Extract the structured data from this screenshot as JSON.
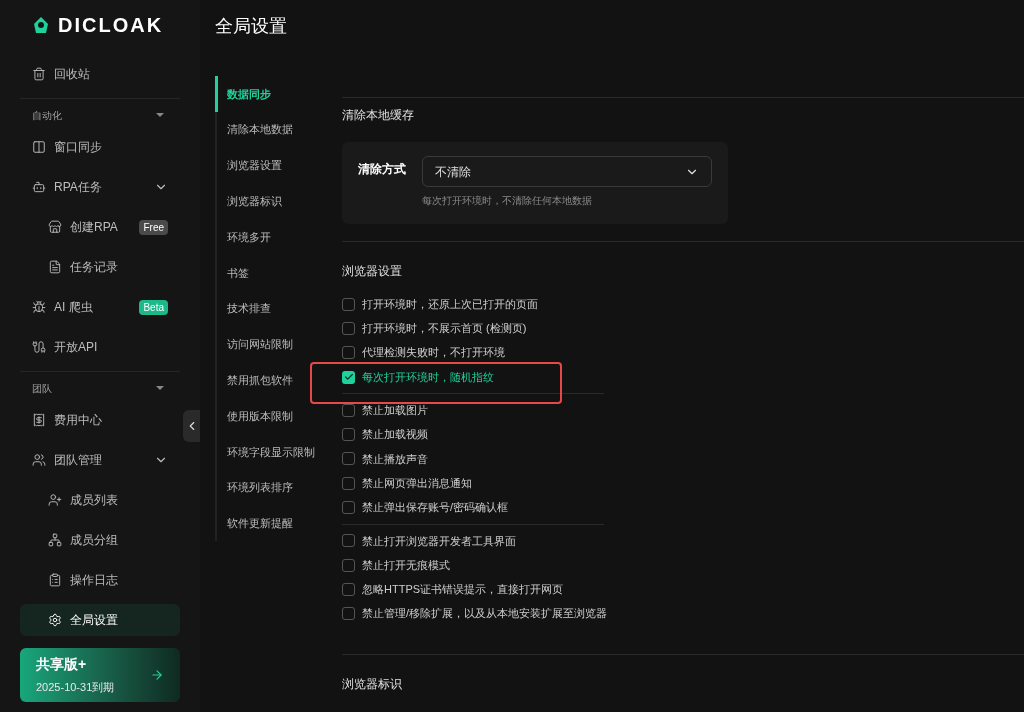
{
  "brand": {
    "name": "DICLOAK"
  },
  "sidebar": {
    "groups": [
      {
        "items": [
          {
            "label": "回收站",
            "selected": false
          }
        ]
      },
      {
        "header": "自动化",
        "items": [
          {
            "label": "窗口同步",
            "selected": false
          },
          {
            "label": "RPA任务",
            "selected": false,
            "expanded": true,
            "children": [
              {
                "label": "创建RPA",
                "selected": false,
                "badge": {
                  "text": "Free",
                  "color": "#4a4a4a"
                }
              },
              {
                "label": "任务记录",
                "selected": false
              }
            ]
          },
          {
            "label": "AI 爬虫",
            "selected": false,
            "badge": {
              "text": "Beta",
              "color": "#1db88a"
            }
          },
          {
            "label": "开放API",
            "selected": false
          }
        ]
      },
      {
        "header": "团队",
        "items": [
          {
            "label": "费用中心",
            "selected": false
          },
          {
            "label": "团队管理",
            "selected": false,
            "expanded": true,
            "children": [
              {
                "label": "成员列表",
                "selected": false
              },
              {
                "label": "成员分组",
                "selected": false
              },
              {
                "label": "操作日志",
                "selected": false
              },
              {
                "label": "全局设置",
                "selected": true
              }
            ]
          }
        ]
      }
    ],
    "plan": {
      "name": "共享版+",
      "expiry": "2025-10-31到期"
    }
  },
  "page": {
    "title": "全局设置"
  },
  "subnav": [
    {
      "label": "数据同步",
      "selected": true
    },
    {
      "label": "清除本地数据",
      "selected": false
    },
    {
      "label": "浏览器设置",
      "selected": false
    },
    {
      "label": "浏览器标识",
      "selected": false
    },
    {
      "label": "环境多开",
      "selected": false
    },
    {
      "label": "书签",
      "selected": false
    },
    {
      "label": "技术排查",
      "selected": false
    },
    {
      "label": "访问网站限制",
      "selected": false
    },
    {
      "label": "禁用抓包软件",
      "selected": false
    },
    {
      "label": "使用版本限制",
      "selected": false
    },
    {
      "label": "环境字段显示限制",
      "selected": false
    },
    {
      "label": "环境列表排序",
      "selected": false
    },
    {
      "label": "软件更新提醒",
      "selected": false
    }
  ],
  "cache": {
    "title": "清除本地缓存",
    "field_label": "清除方式",
    "value": "不清除",
    "hint": "每次打开环境时，不清除任何本地数据"
  },
  "browser_settings": {
    "title": "浏览器设置",
    "groups": [
      [
        {
          "label": "打开环境时，还原上次已打开的页面",
          "checked": false,
          "highlighted": false
        },
        {
          "label": "打开环境时，不展示首页 (检测页)",
          "checked": false,
          "highlighted": false
        },
        {
          "label": "代理检测失败时，不打开环境",
          "checked": false,
          "highlighted": false
        },
        {
          "label": "每次打开环境时，随机指纹",
          "checked": true,
          "highlighted": true
        }
      ],
      [
        {
          "label": "禁止加载图片",
          "checked": false,
          "highlighted": false
        },
        {
          "label": "禁止加载视频",
          "checked": false,
          "highlighted": false
        },
        {
          "label": "禁止播放声音",
          "checked": false,
          "highlighted": false
        },
        {
          "label": "禁止网页弹出消息通知",
          "checked": false,
          "highlighted": false
        },
        {
          "label": "禁止弹出保存账号/密码确认框",
          "checked": false,
          "highlighted": false
        }
      ],
      [
        {
          "label": "禁止打开浏览器开发者工具界面",
          "checked": false,
          "highlighted": false
        },
        {
          "label": "禁止打开无痕模式",
          "checked": false,
          "highlighted": false
        },
        {
          "label": "忽略HTTPS证书错误提示，直接打开网页",
          "checked": false,
          "highlighted": false
        },
        {
          "label": "禁止管理/移除扩展，以及从本地安装扩展至浏览器",
          "checked": false,
          "highlighted": false
        }
      ]
    ]
  },
  "next_section": {
    "title": "浏览器标识"
  }
}
